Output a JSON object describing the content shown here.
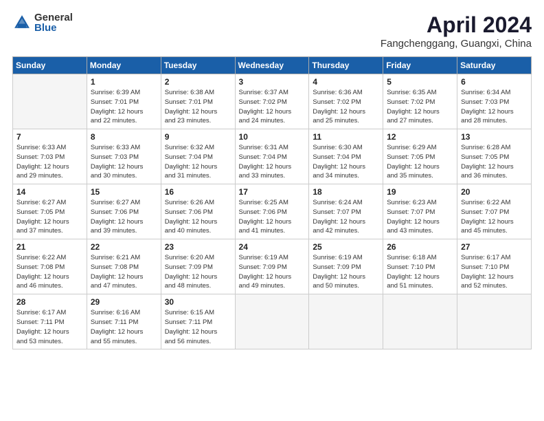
{
  "header": {
    "logo_general": "General",
    "logo_blue": "Blue",
    "title": "April 2024",
    "location": "Fangchenggang, Guangxi, China"
  },
  "weekdays": [
    "Sunday",
    "Monday",
    "Tuesday",
    "Wednesday",
    "Thursday",
    "Friday",
    "Saturday"
  ],
  "weeks": [
    [
      {
        "num": "",
        "info": ""
      },
      {
        "num": "1",
        "info": "Sunrise: 6:39 AM\nSunset: 7:01 PM\nDaylight: 12 hours\nand 22 minutes."
      },
      {
        "num": "2",
        "info": "Sunrise: 6:38 AM\nSunset: 7:01 PM\nDaylight: 12 hours\nand 23 minutes."
      },
      {
        "num": "3",
        "info": "Sunrise: 6:37 AM\nSunset: 7:02 PM\nDaylight: 12 hours\nand 24 minutes."
      },
      {
        "num": "4",
        "info": "Sunrise: 6:36 AM\nSunset: 7:02 PM\nDaylight: 12 hours\nand 25 minutes."
      },
      {
        "num": "5",
        "info": "Sunrise: 6:35 AM\nSunset: 7:02 PM\nDaylight: 12 hours\nand 27 minutes."
      },
      {
        "num": "6",
        "info": "Sunrise: 6:34 AM\nSunset: 7:03 PM\nDaylight: 12 hours\nand 28 minutes."
      }
    ],
    [
      {
        "num": "7",
        "info": "Sunrise: 6:33 AM\nSunset: 7:03 PM\nDaylight: 12 hours\nand 29 minutes."
      },
      {
        "num": "8",
        "info": "Sunrise: 6:33 AM\nSunset: 7:03 PM\nDaylight: 12 hours\nand 30 minutes."
      },
      {
        "num": "9",
        "info": "Sunrise: 6:32 AM\nSunset: 7:04 PM\nDaylight: 12 hours\nand 31 minutes."
      },
      {
        "num": "10",
        "info": "Sunrise: 6:31 AM\nSunset: 7:04 PM\nDaylight: 12 hours\nand 33 minutes."
      },
      {
        "num": "11",
        "info": "Sunrise: 6:30 AM\nSunset: 7:04 PM\nDaylight: 12 hours\nand 34 minutes."
      },
      {
        "num": "12",
        "info": "Sunrise: 6:29 AM\nSunset: 7:05 PM\nDaylight: 12 hours\nand 35 minutes."
      },
      {
        "num": "13",
        "info": "Sunrise: 6:28 AM\nSunset: 7:05 PM\nDaylight: 12 hours\nand 36 minutes."
      }
    ],
    [
      {
        "num": "14",
        "info": "Sunrise: 6:27 AM\nSunset: 7:05 PM\nDaylight: 12 hours\nand 37 minutes."
      },
      {
        "num": "15",
        "info": "Sunrise: 6:27 AM\nSunset: 7:06 PM\nDaylight: 12 hours\nand 39 minutes."
      },
      {
        "num": "16",
        "info": "Sunrise: 6:26 AM\nSunset: 7:06 PM\nDaylight: 12 hours\nand 40 minutes."
      },
      {
        "num": "17",
        "info": "Sunrise: 6:25 AM\nSunset: 7:06 PM\nDaylight: 12 hours\nand 41 minutes."
      },
      {
        "num": "18",
        "info": "Sunrise: 6:24 AM\nSunset: 7:07 PM\nDaylight: 12 hours\nand 42 minutes."
      },
      {
        "num": "19",
        "info": "Sunrise: 6:23 AM\nSunset: 7:07 PM\nDaylight: 12 hours\nand 43 minutes."
      },
      {
        "num": "20",
        "info": "Sunrise: 6:22 AM\nSunset: 7:07 PM\nDaylight: 12 hours\nand 45 minutes."
      }
    ],
    [
      {
        "num": "21",
        "info": "Sunrise: 6:22 AM\nSunset: 7:08 PM\nDaylight: 12 hours\nand 46 minutes."
      },
      {
        "num": "22",
        "info": "Sunrise: 6:21 AM\nSunset: 7:08 PM\nDaylight: 12 hours\nand 47 minutes."
      },
      {
        "num": "23",
        "info": "Sunrise: 6:20 AM\nSunset: 7:09 PM\nDaylight: 12 hours\nand 48 minutes."
      },
      {
        "num": "24",
        "info": "Sunrise: 6:19 AM\nSunset: 7:09 PM\nDaylight: 12 hours\nand 49 minutes."
      },
      {
        "num": "25",
        "info": "Sunrise: 6:19 AM\nSunset: 7:09 PM\nDaylight: 12 hours\nand 50 minutes."
      },
      {
        "num": "26",
        "info": "Sunrise: 6:18 AM\nSunset: 7:10 PM\nDaylight: 12 hours\nand 51 minutes."
      },
      {
        "num": "27",
        "info": "Sunrise: 6:17 AM\nSunset: 7:10 PM\nDaylight: 12 hours\nand 52 minutes."
      }
    ],
    [
      {
        "num": "28",
        "info": "Sunrise: 6:17 AM\nSunset: 7:11 PM\nDaylight: 12 hours\nand 53 minutes."
      },
      {
        "num": "29",
        "info": "Sunrise: 6:16 AM\nSunset: 7:11 PM\nDaylight: 12 hours\nand 55 minutes."
      },
      {
        "num": "30",
        "info": "Sunrise: 6:15 AM\nSunset: 7:11 PM\nDaylight: 12 hours\nand 56 minutes."
      },
      {
        "num": "",
        "info": ""
      },
      {
        "num": "",
        "info": ""
      },
      {
        "num": "",
        "info": ""
      },
      {
        "num": "",
        "info": ""
      }
    ]
  ]
}
